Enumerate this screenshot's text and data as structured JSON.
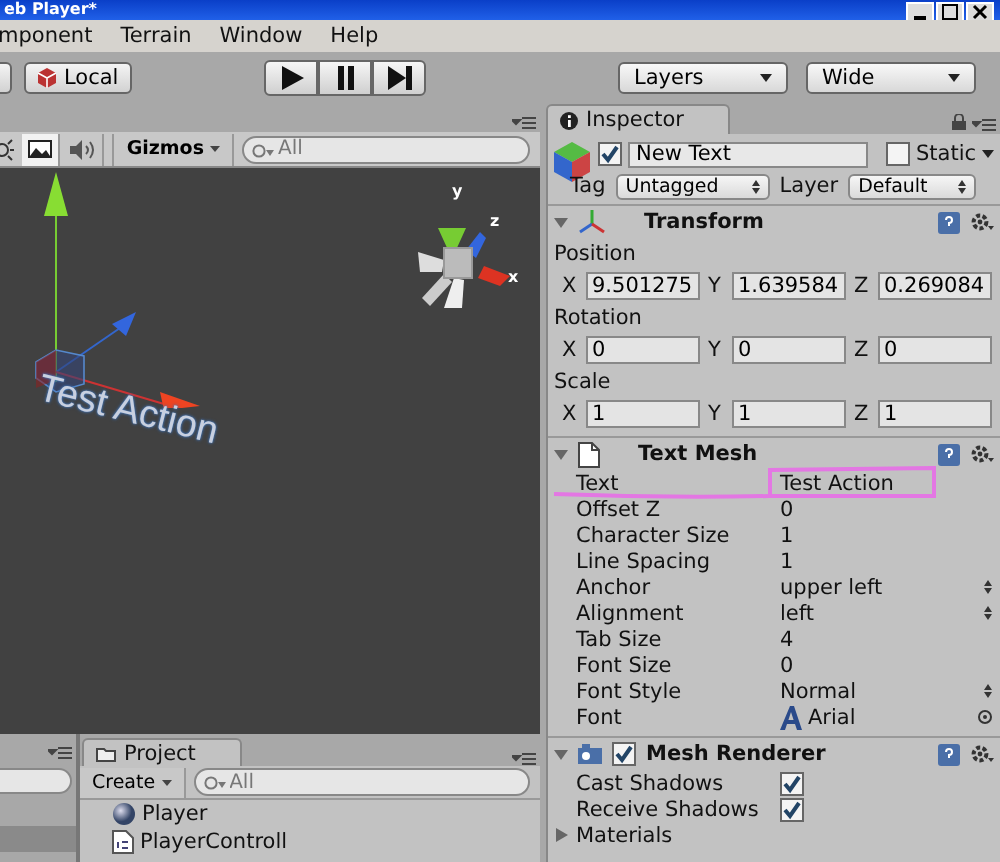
{
  "window": {
    "title": "eb Player*"
  },
  "menu": [
    "mponent",
    "Terrain",
    "Window",
    "Help"
  ],
  "toolbar": {
    "pivot": "Local",
    "layers": "Layers",
    "layout": "Wide"
  },
  "scene": {
    "gizmos": "Gizmos",
    "search_placeholder": "All",
    "axis_labels": [
      "y",
      "z",
      "x"
    ],
    "text_object": "Test Action"
  },
  "inspector": {
    "tab": "Inspector",
    "object": {
      "active": true,
      "name": "New Text",
      "static_label": "Static",
      "static": false
    },
    "tag": {
      "label": "Tag",
      "value": "Untagged"
    },
    "layer": {
      "label": "Layer",
      "value": "Default"
    },
    "transform": {
      "title": "Transform",
      "expanded": true,
      "rows": [
        {
          "label": "Position",
          "fields": [
            {
              "axis": "X",
              "value": "9.501275"
            },
            {
              "axis": "Y",
              "value": "1.639584"
            },
            {
              "axis": "Z",
              "value": "0.269084"
            }
          ]
        },
        {
          "label": "Rotation",
          "fields": [
            {
              "axis": "X",
              "value": "0"
            },
            {
              "axis": "Y",
              "value": "0"
            },
            {
              "axis": "Z",
              "value": "0"
            }
          ]
        },
        {
          "label": "Scale",
          "fields": [
            {
              "axis": "X",
              "value": "1"
            },
            {
              "axis": "Y",
              "value": "1"
            },
            {
              "axis": "Z",
              "value": "1"
            }
          ]
        }
      ]
    },
    "text_mesh": {
      "title": "Text Mesh",
      "expanded": true,
      "properties": [
        {
          "label": "Text",
          "value": "Test Action",
          "kind": "text"
        },
        {
          "label": "Offset Z",
          "value": "0",
          "kind": "text"
        },
        {
          "label": "Character Size",
          "value": "1",
          "kind": "text"
        },
        {
          "label": "Line Spacing",
          "value": "1",
          "kind": "text"
        },
        {
          "label": "Anchor",
          "value": "upper left",
          "kind": "dropdown"
        },
        {
          "label": "Alignment",
          "value": "left",
          "kind": "dropdown"
        },
        {
          "label": "Tab Size",
          "value": "4",
          "kind": "text"
        },
        {
          "label": "Font Size",
          "value": "0",
          "kind": "text"
        },
        {
          "label": "Font Style",
          "value": "Normal",
          "kind": "dropdown"
        },
        {
          "label": "Font",
          "value": "Arial",
          "kind": "object"
        }
      ]
    },
    "mesh_renderer": {
      "title": "Mesh Renderer",
      "enabled": true,
      "expanded": true,
      "properties": [
        {
          "label": "Cast Shadows",
          "kind": "checkbox",
          "checked": true
        },
        {
          "label": "Receive Shadows",
          "kind": "checkbox",
          "checked": true
        },
        {
          "label": "Materials",
          "kind": "foldout",
          "expanded": false
        }
      ]
    }
  },
  "project": {
    "tab": "Project",
    "create": "Create",
    "search_placeholder": "All",
    "items": [
      {
        "name": "Player",
        "kind": "prefab"
      },
      {
        "name": "PlayerControll",
        "kind": "script"
      }
    ]
  }
}
